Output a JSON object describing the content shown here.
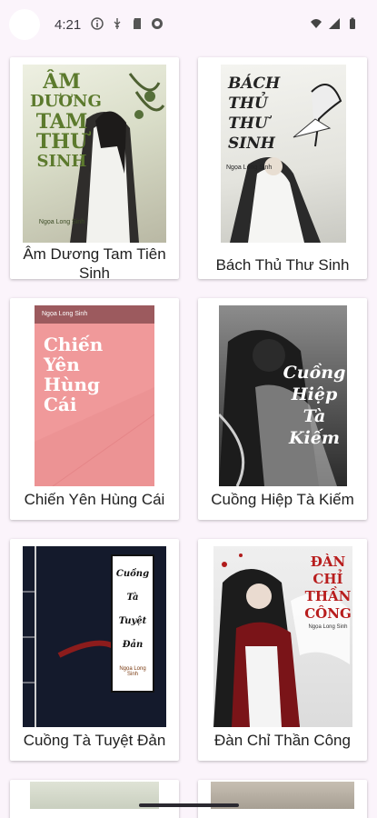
{
  "status": {
    "time": "4:21"
  },
  "books": [
    {
      "title": "Âm Dương Tam Tiên Sinh",
      "cover_text": [
        "ÂM",
        "DƯƠNG",
        "TAM",
        "THƯ",
        "SINH"
      ],
      "cover_author": "Ngọa Long Sinh"
    },
    {
      "title": "Bách Thủ Thư Sinh",
      "cover_text": [
        "BÁCH",
        "THỦ",
        "THƯ",
        "SINH"
      ],
      "cover_author": "Ngọa Long Sinh"
    },
    {
      "title": "Chiến Yên Hùng Cái",
      "cover_text": [
        "Chiến",
        "Yên",
        "Hùng",
        "Cái"
      ],
      "cover_author": "Ngọa Long Sinh"
    },
    {
      "title": "Cuồng Hiệp Tà Kiếm",
      "cover_text": [
        "Cuồng",
        "Hiệp",
        "Tà",
        "Kiếm"
      ],
      "cover_author": ""
    },
    {
      "title": "Cuồng Tà Tuyệt Đản",
      "cover_text": [
        "Cuồng",
        "Tà",
        "Tuyệt",
        "Đản"
      ],
      "cover_author": "Ngọa Long Sinh"
    },
    {
      "title": "Đàn Chỉ Thần Công",
      "cover_text": [
        "ĐÀN",
        "CHỈ",
        "THẦN",
        "CÔNG"
      ],
      "cover_author": "Ngọa Long Sinh"
    }
  ],
  "colors": {
    "background": "#fbf4fb",
    "card": "#ffffff",
    "cover_pink": "#f0999a"
  }
}
